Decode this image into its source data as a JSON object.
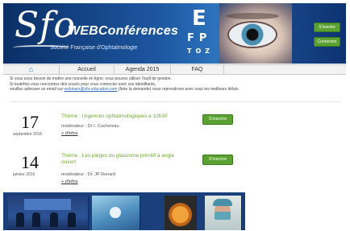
{
  "banner": {
    "logo_text": "Sfo",
    "brand": "WEBConférences",
    "society": "Société Française d'Ophtalmologie",
    "eyechart": {
      "row1": "E",
      "row2": "FP",
      "row3": "TOZ"
    },
    "buttons": [
      "S'inscrire",
      "Connexion"
    ]
  },
  "nav": {
    "home_icon": "home-icon",
    "items": [
      "Accueil",
      "Agenda 2015",
      "FAQ"
    ]
  },
  "notice": {
    "line1": "Si vous avez besoin de mettre une nouvelle en ligne, vous pouvez utiliser l'outil de gestion.",
    "line2": "Si toutefois vous rencontrez des soucis pour vous connecter avec vos identifiants,",
    "line3_pre": "veuillez adresser un email sur ",
    "line3_link": "webinars@sfo-education.com",
    "line3_post": " (faire la demande) nous reprendrons avec vous les meilleurs délais."
  },
  "events": [
    {
      "day": "17",
      "month_year": "septembre 2015",
      "theme": "Thème : Urgences ophtalmologiques à 10h30",
      "moderator": "modérateur : Dr I. Cochereau",
      "link": "+ d'infos",
      "button": "S'inscrire"
    },
    {
      "day": "14",
      "month_year": "janvier 2016",
      "theme": "Thème : Les pièges du glaucome primitif à angle ouvert",
      "moderator": "modérateur : Dr. JP Renard",
      "link": "+ d'infos",
      "button": "S'inscrire"
    }
  ],
  "colors": {
    "banner_blue": "#1d56a0",
    "accent_green": "#5aa132",
    "theme_green": "#6fa832",
    "link_blue": "#2f6db3"
  }
}
